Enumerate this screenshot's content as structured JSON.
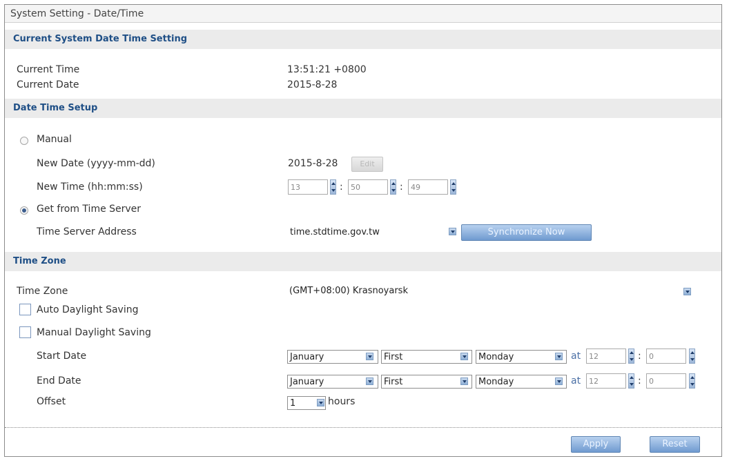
{
  "window": {
    "title": "System Setting - Date/Time"
  },
  "sections": {
    "current": "Current System Date Time Setting",
    "setup": "Date Time Setup",
    "timezone": "Time Zone"
  },
  "current": {
    "time_label": "Current Time",
    "time_value": "13:51:21 +0800",
    "date_label": "Current Date",
    "date_value": "2015-8-28"
  },
  "setup": {
    "manual_label": "Manual",
    "manual_selected": false,
    "new_date_label": "New Date (yyyy-mm-dd)",
    "new_date_value": "2015-8-28",
    "edit_label": "Edit",
    "new_time_label": "New Time (hh:mm:ss)",
    "hour": "13",
    "minute": "50",
    "second": "49",
    "server_label": "Get from Time Server",
    "server_selected": true,
    "server_address_label": "Time Server Address",
    "server_address_value": "time.stdtime.gov.tw",
    "sync_label": "Synchronize Now"
  },
  "timezone": {
    "label": "Time Zone",
    "value": "(GMT+08:00) Krasnoyarsk",
    "auto_dst_label": "Auto Daylight Saving",
    "manual_dst_label": "Manual Daylight Saving",
    "start_label": "Start Date",
    "end_label": "End Date",
    "offset_label": "Offset",
    "start": {
      "month": "January",
      "week": "First",
      "day": "Monday",
      "at": "at",
      "hour": "12",
      "minute": "0"
    },
    "end": {
      "month": "January",
      "week": "First",
      "day": "Monday",
      "at": "at",
      "hour": "12",
      "minute": "0"
    },
    "offset_value": "1",
    "offset_unit": "hours"
  },
  "footer": {
    "apply_label": "Apply",
    "reset_label": "Reset"
  },
  "colors": {
    "section_text": "#1f4f86",
    "button": "#6f9ad0"
  }
}
